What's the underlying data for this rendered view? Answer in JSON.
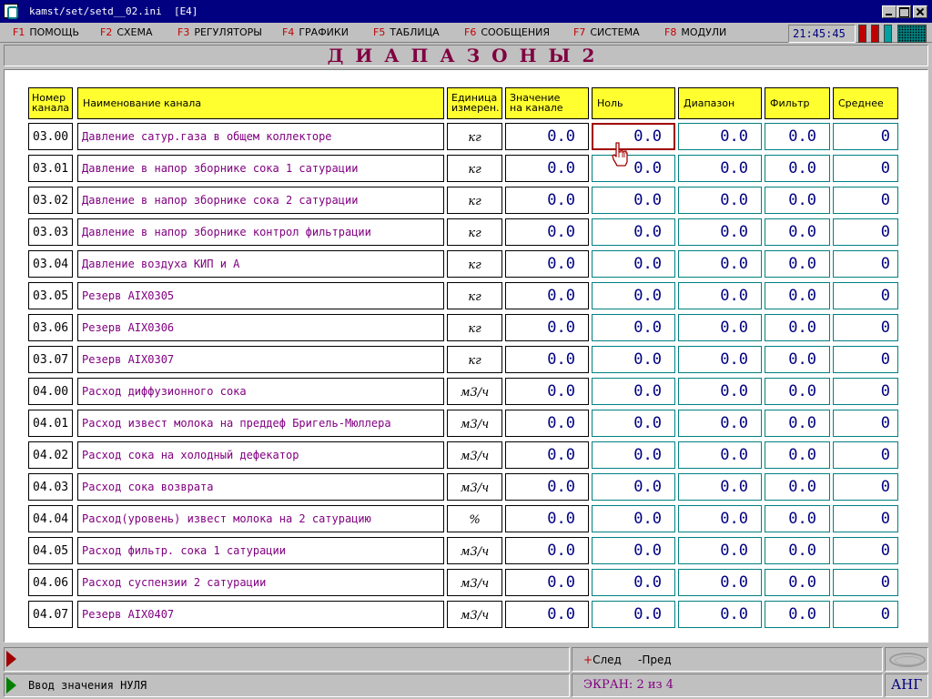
{
  "window": {
    "title": "kamst/set/setd__02.ini  [E4]"
  },
  "menu": [
    {
      "key": "F1",
      "label": "ПОМОЩЬ"
    },
    {
      "key": "F2",
      "label": "СХЕМА"
    },
    {
      "key": "F3",
      "label": "РЕГУЛЯТОРЫ"
    },
    {
      "key": "F4",
      "label": "ГРАФИКИ"
    },
    {
      "key": "F5",
      "label": "ТАБЛИЦА"
    },
    {
      "key": "F6",
      "label": "СООБЩЕНИЯ"
    },
    {
      "key": "F7",
      "label": "СИСТЕМА"
    },
    {
      "key": "F8",
      "label": "МОДУЛИ"
    }
  ],
  "clock": "21:45:45",
  "status_lights": {
    "light1": "#c00000",
    "light2": "#c00000",
    "light3": "#00a0a0"
  },
  "screen_title": "ДИАПАЗОНЫ2",
  "table": {
    "headers": {
      "num_line1": "Номер",
      "num_line2": "канала",
      "name": "Наименование канала",
      "unit_line1": "Единица",
      "unit_line2": "измерен.",
      "value_line1": "Значение",
      "value_line2": "на канале",
      "zero": "Ноль",
      "range": "Диапазон",
      "filter": "Фильтр",
      "avg": "Среднее"
    },
    "rows": [
      {
        "num": "03.00",
        "name": "Давление сатур.газа в общем коллекторе",
        "unit": "кг",
        "value": "0.0",
        "zero": "0.0",
        "range": "0.0",
        "filter": "0.0",
        "avg": "0"
      },
      {
        "num": "03.01",
        "name": "Давление в напор зборнике сока 1 сатурации",
        "unit": "кг",
        "value": "0.0",
        "zero": "0.0",
        "range": "0.0",
        "filter": "0.0",
        "avg": "0"
      },
      {
        "num": "03.02",
        "name": "Давление в напор зборнике сока 2 сатурации",
        "unit": "кг",
        "value": "0.0",
        "zero": "0.0",
        "range": "0.0",
        "filter": "0.0",
        "avg": "0"
      },
      {
        "num": "03.03",
        "name": "Давление в напор зборнике контрол фильтрации",
        "unit": "кг",
        "value": "0.0",
        "zero": "0.0",
        "range": "0.0",
        "filter": "0.0",
        "avg": "0"
      },
      {
        "num": "03.04",
        "name": "Давление воздуха КИП и А",
        "unit": "кг",
        "value": "0.0",
        "zero": "0.0",
        "range": "0.0",
        "filter": "0.0",
        "avg": "0"
      },
      {
        "num": "03.05",
        "name": "Резерв AIX0305",
        "unit": "кг",
        "value": "0.0",
        "zero": "0.0",
        "range": "0.0",
        "filter": "0.0",
        "avg": "0"
      },
      {
        "num": "03.06",
        "name": "Резерв AIX0306",
        "unit": "кг",
        "value": "0.0",
        "zero": "0.0",
        "range": "0.0",
        "filter": "0.0",
        "avg": "0"
      },
      {
        "num": "03.07",
        "name": "Резерв AIX0307",
        "unit": "кг",
        "value": "0.0",
        "zero": "0.0",
        "range": "0.0",
        "filter": "0.0",
        "avg": "0"
      },
      {
        "num": "04.00",
        "name": "Расход диффузионного сока",
        "unit": "м3/ч",
        "value": "0.0",
        "zero": "0.0",
        "range": "0.0",
        "filter": "0.0",
        "avg": "0"
      },
      {
        "num": "04.01",
        "name": "Расход извест молока на преддеф Бригель-Мюллера",
        "unit": "м3/ч",
        "value": "0.0",
        "zero": "0.0",
        "range": "0.0",
        "filter": "0.0",
        "avg": "0"
      },
      {
        "num": "04.02",
        "name": "Расход сока на холодный дефекатор",
        "unit": "м3/ч",
        "value": "0.0",
        "zero": "0.0",
        "range": "0.0",
        "filter": "0.0",
        "avg": "0"
      },
      {
        "num": "04.03",
        "name": "Расход сока возврата",
        "unit": "м3/ч",
        "value": "0.0",
        "zero": "0.0",
        "range": "0.0",
        "filter": "0.0",
        "avg": "0"
      },
      {
        "num": "04.04",
        "name": "Расход(уровень) извест молока на 2 сатурацию",
        "unit": "%",
        "value": "0.0",
        "zero": "0.0",
        "range": "0.0",
        "filter": "0.0",
        "avg": "0"
      },
      {
        "num": "04.05",
        "name": "Расход фильтр. сока 1 сатурации",
        "unit": "м3/ч",
        "value": "0.0",
        "zero": "0.0",
        "range": "0.0",
        "filter": "0.0",
        "avg": "0"
      },
      {
        "num": "04.06",
        "name": "Расход суспензии 2 сатурации",
        "unit": "м3/ч",
        "value": "0.0",
        "zero": "0.0",
        "range": "0.0",
        "filter": "0.0",
        "avg": "0"
      },
      {
        "num": "04.07",
        "name": "Резерв  AIX0407",
        "unit": "м3/ч",
        "value": "0.0",
        "zero": "0.0",
        "range": "0.0",
        "filter": "0.0",
        "avg": "0"
      }
    ]
  },
  "status": {
    "hint": "Ввод значения НУЛЯ",
    "nav_next_sign": "+",
    "nav_next": "След",
    "nav_prev": "-Пред",
    "screen_indicator": "ЭКРАН: 2 из 4",
    "language": "АНГ"
  },
  "colors": {
    "header_bg": "#ffff30",
    "channel_name": "#800080",
    "value_text": "#000080",
    "edit_border": "#008080",
    "active_border": "#a00000",
    "title_text": "#800040"
  }
}
